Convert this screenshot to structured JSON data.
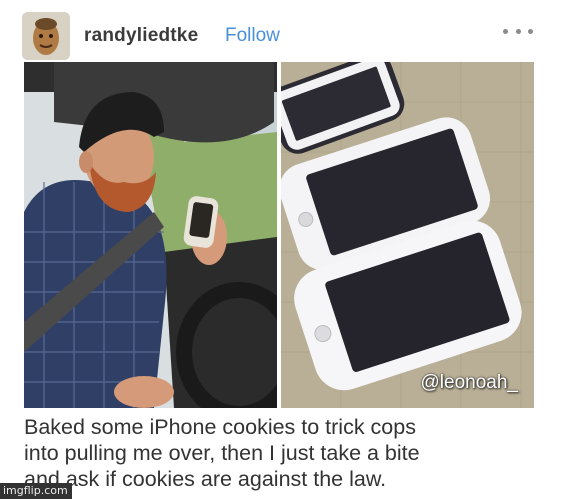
{
  "post": {
    "username": "randyliedtke",
    "follow_label": "Follow",
    "more_label": "More options",
    "watermark": "@leonoah_",
    "caption_lines": [
      "Baked some iPhone cookies to trick cops",
      "into pulling me over, then I just take a bite",
      "and ask if cookies are against the law."
    ],
    "site_watermark": "imgflip.com"
  },
  "icons": {
    "more": "ellipsis-icon"
  },
  "colors": {
    "follow": "#4a90d9",
    "username": "#3b3b3b",
    "caption": "#333333"
  }
}
